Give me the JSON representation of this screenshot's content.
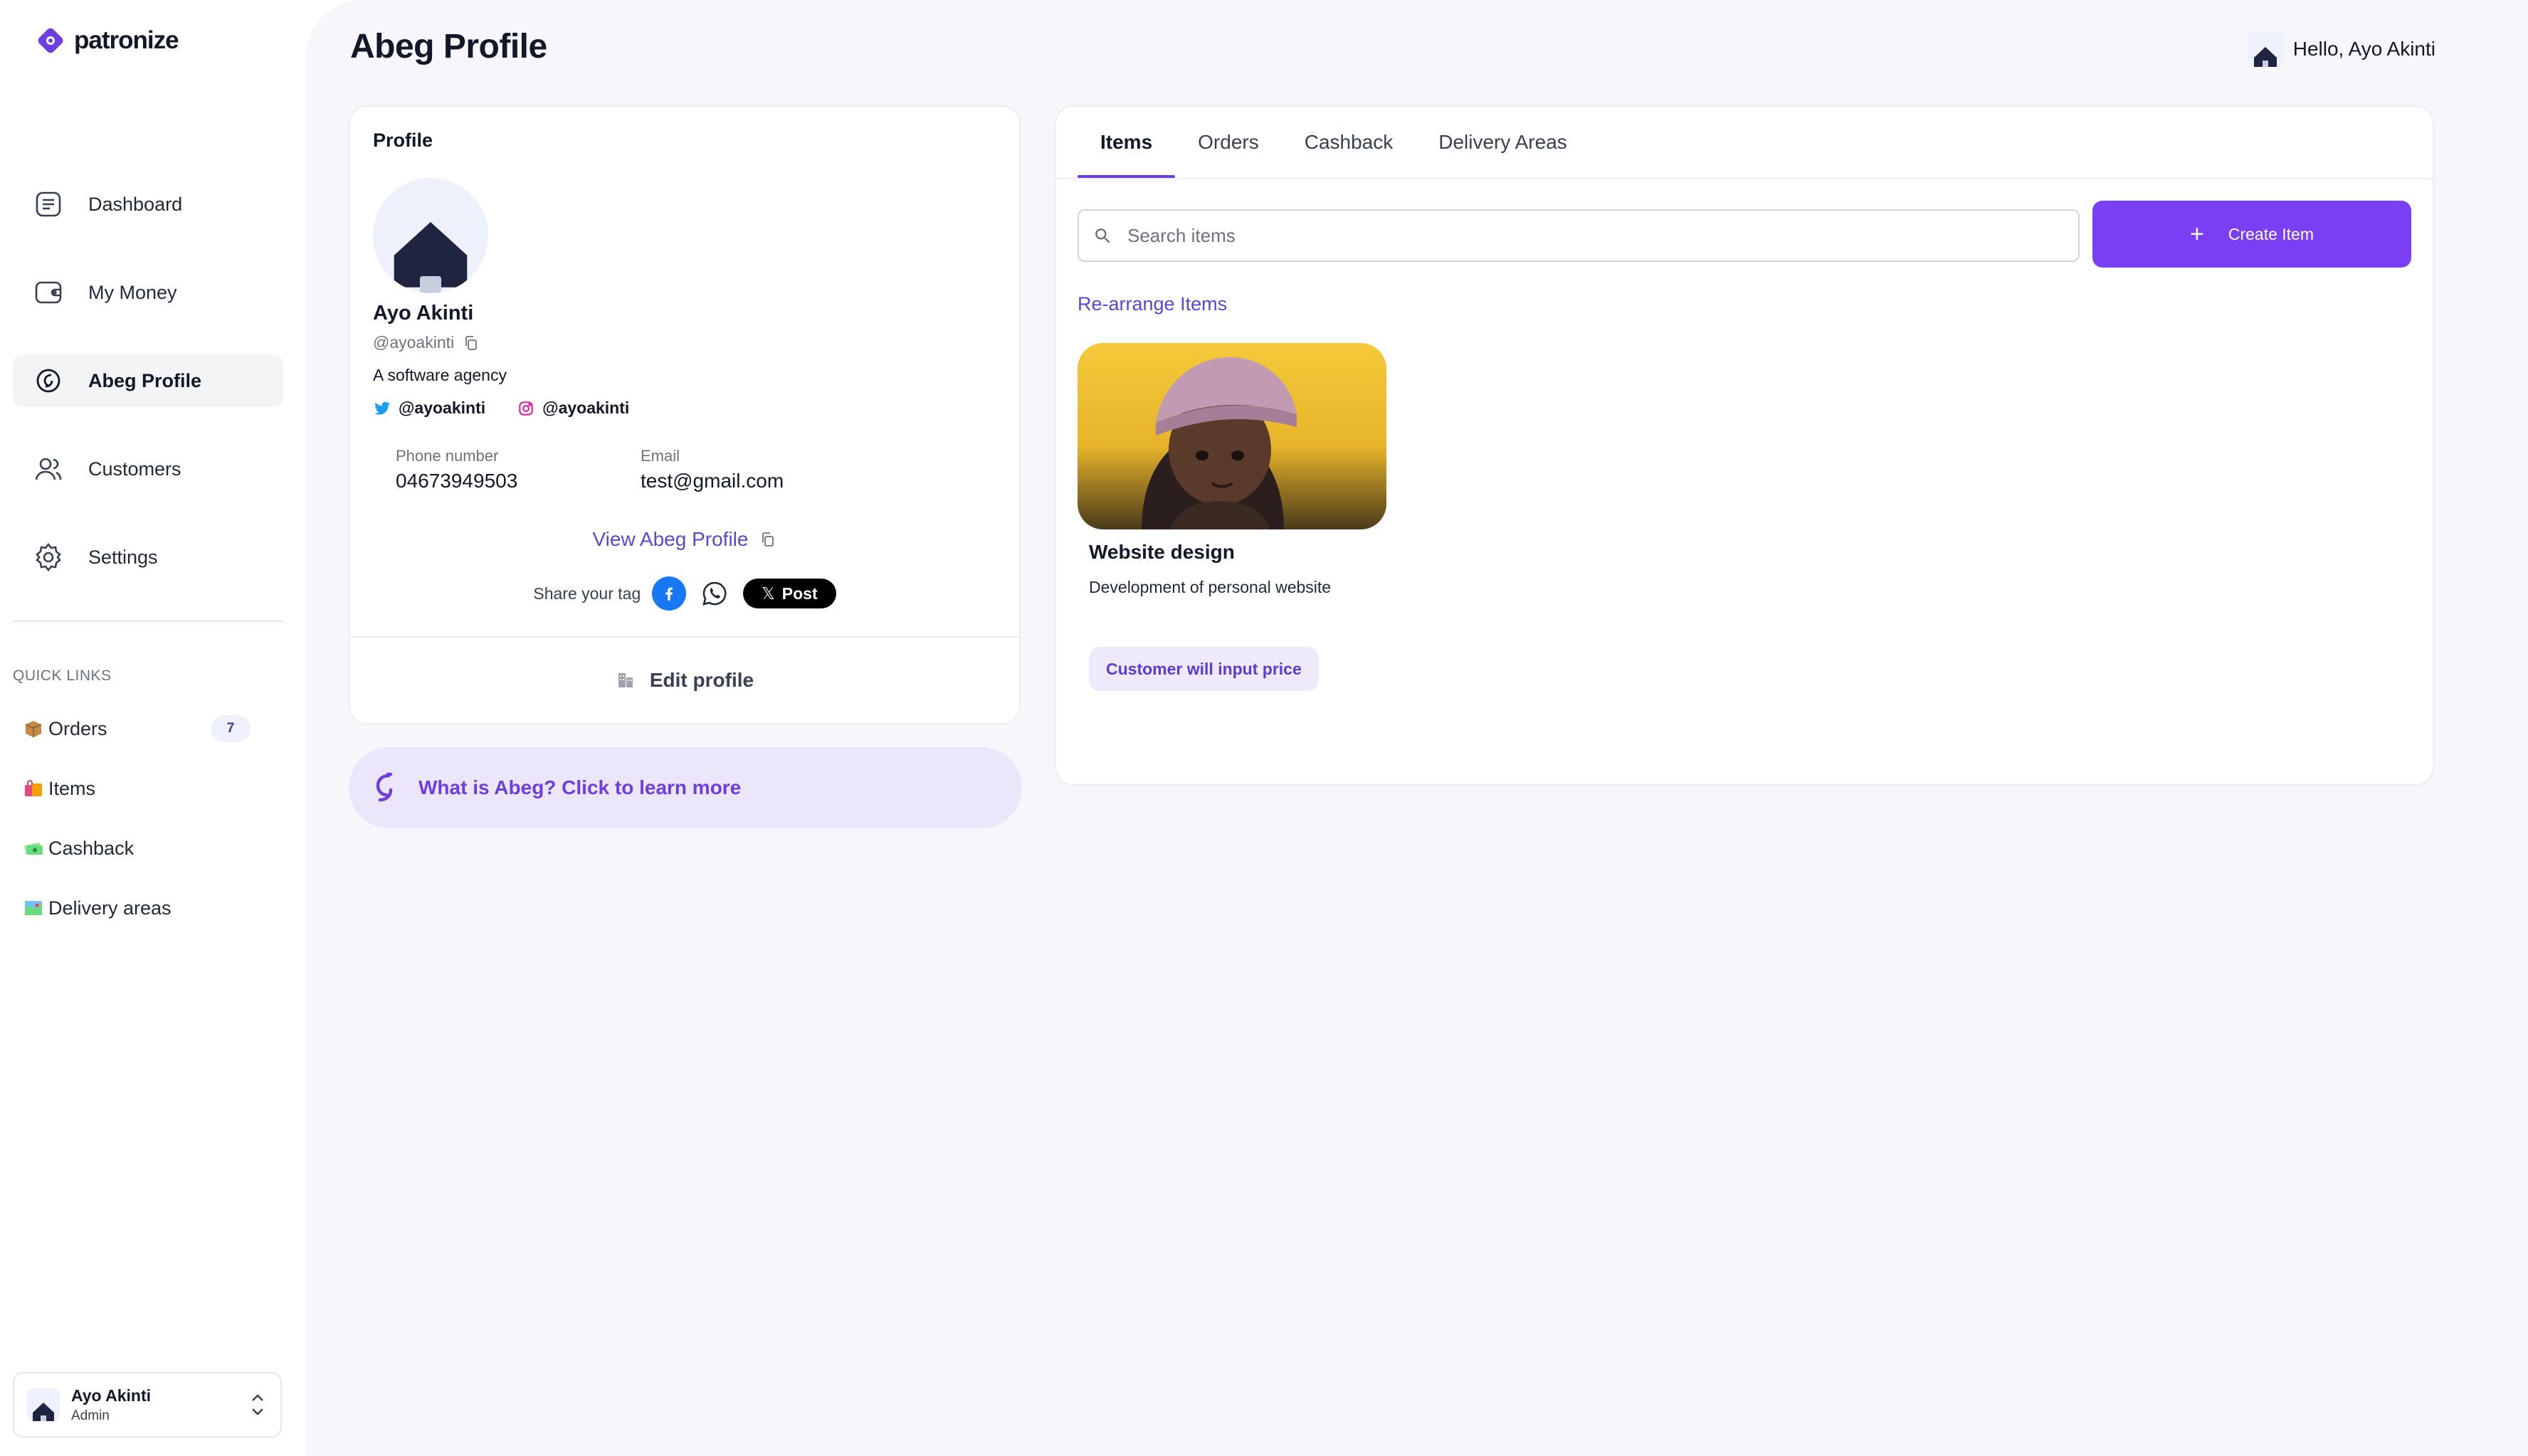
{
  "brand": {
    "name": "patronize",
    "accent": "#7a3ff2"
  },
  "sidebar": {
    "items": [
      {
        "label": "Dashboard",
        "icon": "dashboard-icon"
      },
      {
        "label": "My Money",
        "icon": "wallet-icon"
      },
      {
        "label": "Abeg Profile",
        "icon": "abeg-icon",
        "active": true
      },
      {
        "label": "Customers",
        "icon": "customers-icon"
      },
      {
        "label": "Settings",
        "icon": "gear-icon"
      }
    ],
    "quick_links_title": "QUICK LINKS",
    "quick_links": [
      {
        "label": "Orders",
        "icon": "package-icon",
        "badge": "7"
      },
      {
        "label": "Items",
        "icon": "shopping-bags-icon"
      },
      {
        "label": "Cashback",
        "icon": "money-icon"
      },
      {
        "label": "Delivery areas",
        "icon": "map-icon"
      }
    ],
    "user": {
      "name": "Ayo Akinti",
      "role": "Admin"
    }
  },
  "header": {
    "title": "Abeg Profile",
    "greeting": "Hello, Ayo Akinti"
  },
  "profile": {
    "heading": "Profile",
    "name": "Ayo Akinti",
    "handle": "@ayoakinti",
    "bio": "A software agency",
    "twitter": "@ayoakinti",
    "instagram": "@ayoakinti",
    "phone_label": "Phone number",
    "phone": "04673949503",
    "email_label": "Email",
    "email": "test@gmail.com",
    "view_link": "View Abeg Profile",
    "share_label": "Share your tag",
    "x_post": "Post",
    "edit_label": "Edit profile"
  },
  "banner": {
    "text": "What is Abeg? Click to learn more"
  },
  "tabs": [
    {
      "label": "Items",
      "active": true
    },
    {
      "label": "Orders"
    },
    {
      "label": "Cashback"
    },
    {
      "label": "Delivery Areas"
    }
  ],
  "items_panel": {
    "search_placeholder": "Search items",
    "create_label": "Create Item",
    "rearrange_label": "Re-arrange Items",
    "items": [
      {
        "title": "Website design",
        "description": "Development of personal website",
        "price_label": "Customer will input price"
      }
    ]
  }
}
